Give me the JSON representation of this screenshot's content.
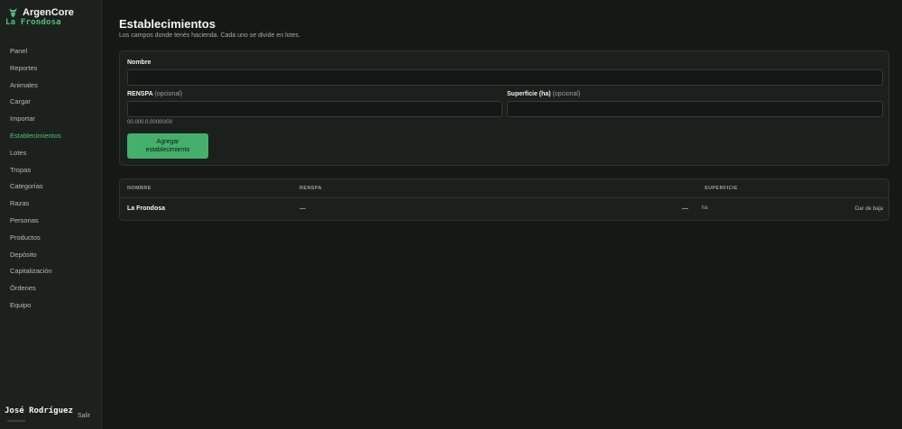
{
  "sidebar": {
    "brand": "ArgenCore",
    "org": "La Frondosa",
    "items": [
      {
        "label": "Panel"
      },
      {
        "label": "Reportes"
      },
      {
        "label": "Animales"
      },
      {
        "label": "Cargar"
      },
      {
        "label": "Importar"
      },
      {
        "label": "Establecimientos",
        "active": true
      },
      {
        "label": "Lotes"
      },
      {
        "label": "Tropas"
      },
      {
        "label": "Categorías"
      },
      {
        "label": "Razas"
      },
      {
        "label": "Personas"
      },
      {
        "label": "Productos"
      },
      {
        "label": "Depósito"
      },
      {
        "label": "Capitalización"
      },
      {
        "label": "Órdenes"
      },
      {
        "label": "Equipo"
      }
    ],
    "user": "José Rodríguez",
    "logout": "Salir"
  },
  "colors": {
    "accent": "#4fc07a",
    "button": "#45b06c",
    "background": "#151815",
    "sidebar": "#1d211e"
  },
  "icons": {
    "brand": "cow-head-icon"
  },
  "page": {
    "title": "Establecimientos",
    "subtitle": "Los campos donde tenés hacienda. Cada uno se divide en lotes."
  },
  "form": {
    "nombre_label": "Nombre",
    "nombre_value": "",
    "renspa_label": "RENSPA",
    "renspa_optional": "(opcional)",
    "renspa_value": "",
    "renspa_hint": "00.000.0.00000/00",
    "superficie_label": "Superficie (ha)",
    "superficie_optional": "(opcional)",
    "superficie_value": "",
    "submit_line1": "Agregar",
    "submit_line2": "establecimiento"
  },
  "table": {
    "headers": {
      "nombre": "NOMBRE",
      "renspa": "RENSPA",
      "superficie": "SUPERFICIE"
    },
    "rows": [
      {
        "nombre": "La Frondosa",
        "renspa": "—",
        "superficie": "—",
        "unit": "ha",
        "action": "Dar de baja"
      }
    ]
  }
}
